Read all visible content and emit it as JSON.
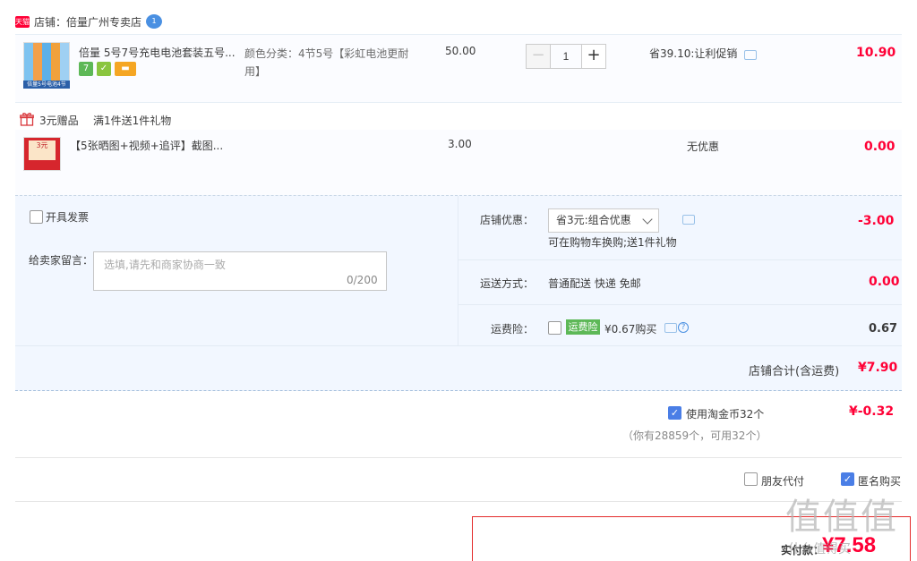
{
  "shop": {
    "badge": "天猫",
    "name": "店铺：倍量广州专卖店",
    "wangwang_badge": "1"
  },
  "item": {
    "image_caption": "倍量5号电池4节",
    "title": "倍量 5号7号充电电池套装五号...",
    "service_icons": [
      "7",
      "✓",
      "▬"
    ],
    "sku": "颜色分类：4节5号【彩虹电池更耐用】",
    "unit_price": "50.00",
    "qty_minus": "−",
    "qty": "1",
    "qty_plus": "+",
    "promo": "省39.10:让利促销",
    "total": "10.90"
  },
  "gift": {
    "label": "3元赠品",
    "rule": "满1件送1件礼物",
    "image_text": "3元",
    "title": "【5张晒图+视频+追评】截图...",
    "price": "3.00",
    "promo": "无优惠",
    "total": "0.00"
  },
  "options": {
    "invoice": "开具发票",
    "message_label": "给卖家留言：",
    "message_placeholder": "选填,请先和商家协商一致",
    "message_count": "0/200",
    "shop_discount_label": "店铺优惠：",
    "shop_discount_value": "省3元:组合优惠",
    "shop_discount_note": "可在购物车换购;送1件礼物",
    "shop_discount_amount": "-3.00",
    "shipping_label": "运送方式：",
    "shipping_value": "普通配送 快递 免邮",
    "shipping_amount": "0.00",
    "insurance_label": "运费险：",
    "insurance_badge": "运费险",
    "insurance_text": "¥0.67购买",
    "insurance_amount": "0.67",
    "shop_total_label": "店铺合计(含运费)",
    "shop_total_value": "¥7.90"
  },
  "coins": {
    "label": "使用淘金币32个",
    "sub": "（你有28859个，可用32个）",
    "value": "¥-0.32"
  },
  "payment": {
    "friend_pay": "朋友代付",
    "anonymous": "匿名购买",
    "final_label": "实付款：",
    "final_value": "¥7.58"
  },
  "watermark": {
    "main": "值值值",
    "sub": "什么值得买"
  },
  "colors": {
    "accent_red": "#ff0036",
    "panel_bg": "#f2f7ff",
    "checkbox_blue": "#4a7ee6"
  }
}
